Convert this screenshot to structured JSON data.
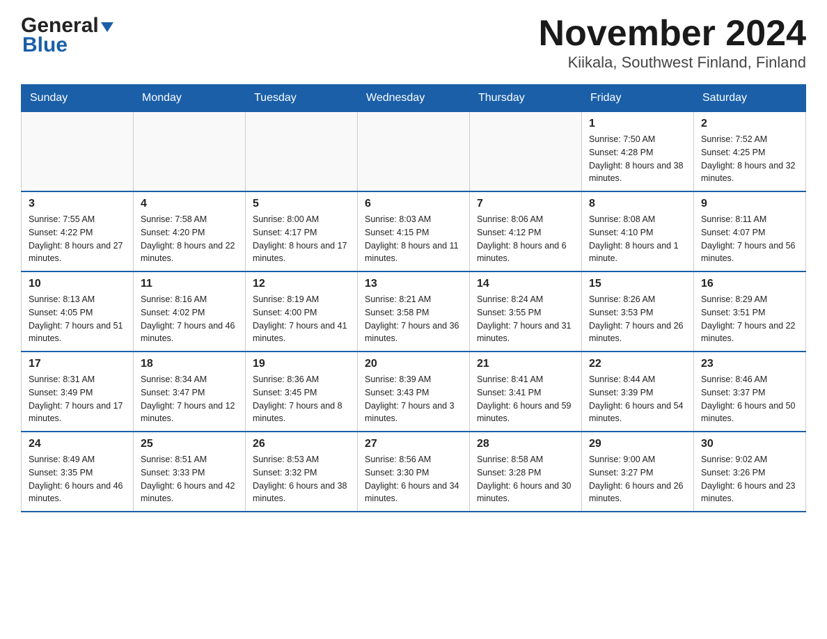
{
  "header": {
    "logo_general": "General",
    "logo_blue": "Blue",
    "title": "November 2024",
    "subtitle": "Kiikala, Southwest Finland, Finland"
  },
  "weekdays": [
    "Sunday",
    "Monday",
    "Tuesday",
    "Wednesday",
    "Thursday",
    "Friday",
    "Saturday"
  ],
  "weeks": [
    {
      "days": [
        {
          "number": "",
          "info": ""
        },
        {
          "number": "",
          "info": ""
        },
        {
          "number": "",
          "info": ""
        },
        {
          "number": "",
          "info": ""
        },
        {
          "number": "",
          "info": ""
        },
        {
          "number": "1",
          "info": "Sunrise: 7:50 AM\nSunset: 4:28 PM\nDaylight: 8 hours\nand 38 minutes."
        },
        {
          "number": "2",
          "info": "Sunrise: 7:52 AM\nSunset: 4:25 PM\nDaylight: 8 hours\nand 32 minutes."
        }
      ]
    },
    {
      "days": [
        {
          "number": "3",
          "info": "Sunrise: 7:55 AM\nSunset: 4:22 PM\nDaylight: 8 hours\nand 27 minutes."
        },
        {
          "number": "4",
          "info": "Sunrise: 7:58 AM\nSunset: 4:20 PM\nDaylight: 8 hours\nand 22 minutes."
        },
        {
          "number": "5",
          "info": "Sunrise: 8:00 AM\nSunset: 4:17 PM\nDaylight: 8 hours\nand 17 minutes."
        },
        {
          "number": "6",
          "info": "Sunrise: 8:03 AM\nSunset: 4:15 PM\nDaylight: 8 hours\nand 11 minutes."
        },
        {
          "number": "7",
          "info": "Sunrise: 8:06 AM\nSunset: 4:12 PM\nDaylight: 8 hours\nand 6 minutes."
        },
        {
          "number": "8",
          "info": "Sunrise: 8:08 AM\nSunset: 4:10 PM\nDaylight: 8 hours\nand 1 minute."
        },
        {
          "number": "9",
          "info": "Sunrise: 8:11 AM\nSunset: 4:07 PM\nDaylight: 7 hours\nand 56 minutes."
        }
      ]
    },
    {
      "days": [
        {
          "number": "10",
          "info": "Sunrise: 8:13 AM\nSunset: 4:05 PM\nDaylight: 7 hours\nand 51 minutes."
        },
        {
          "number": "11",
          "info": "Sunrise: 8:16 AM\nSunset: 4:02 PM\nDaylight: 7 hours\nand 46 minutes."
        },
        {
          "number": "12",
          "info": "Sunrise: 8:19 AM\nSunset: 4:00 PM\nDaylight: 7 hours\nand 41 minutes."
        },
        {
          "number": "13",
          "info": "Sunrise: 8:21 AM\nSunset: 3:58 PM\nDaylight: 7 hours\nand 36 minutes."
        },
        {
          "number": "14",
          "info": "Sunrise: 8:24 AM\nSunset: 3:55 PM\nDaylight: 7 hours\nand 31 minutes."
        },
        {
          "number": "15",
          "info": "Sunrise: 8:26 AM\nSunset: 3:53 PM\nDaylight: 7 hours\nand 26 minutes."
        },
        {
          "number": "16",
          "info": "Sunrise: 8:29 AM\nSunset: 3:51 PM\nDaylight: 7 hours\nand 22 minutes."
        }
      ]
    },
    {
      "days": [
        {
          "number": "17",
          "info": "Sunrise: 8:31 AM\nSunset: 3:49 PM\nDaylight: 7 hours\nand 17 minutes."
        },
        {
          "number": "18",
          "info": "Sunrise: 8:34 AM\nSunset: 3:47 PM\nDaylight: 7 hours\nand 12 minutes."
        },
        {
          "number": "19",
          "info": "Sunrise: 8:36 AM\nSunset: 3:45 PM\nDaylight: 7 hours\nand 8 minutes."
        },
        {
          "number": "20",
          "info": "Sunrise: 8:39 AM\nSunset: 3:43 PM\nDaylight: 7 hours\nand 3 minutes."
        },
        {
          "number": "21",
          "info": "Sunrise: 8:41 AM\nSunset: 3:41 PM\nDaylight: 6 hours\nand 59 minutes."
        },
        {
          "number": "22",
          "info": "Sunrise: 8:44 AM\nSunset: 3:39 PM\nDaylight: 6 hours\nand 54 minutes."
        },
        {
          "number": "23",
          "info": "Sunrise: 8:46 AM\nSunset: 3:37 PM\nDaylight: 6 hours\nand 50 minutes."
        }
      ]
    },
    {
      "days": [
        {
          "number": "24",
          "info": "Sunrise: 8:49 AM\nSunset: 3:35 PM\nDaylight: 6 hours\nand 46 minutes."
        },
        {
          "number": "25",
          "info": "Sunrise: 8:51 AM\nSunset: 3:33 PM\nDaylight: 6 hours\nand 42 minutes."
        },
        {
          "number": "26",
          "info": "Sunrise: 8:53 AM\nSunset: 3:32 PM\nDaylight: 6 hours\nand 38 minutes."
        },
        {
          "number": "27",
          "info": "Sunrise: 8:56 AM\nSunset: 3:30 PM\nDaylight: 6 hours\nand 34 minutes."
        },
        {
          "number": "28",
          "info": "Sunrise: 8:58 AM\nSunset: 3:28 PM\nDaylight: 6 hours\nand 30 minutes."
        },
        {
          "number": "29",
          "info": "Sunrise: 9:00 AM\nSunset: 3:27 PM\nDaylight: 6 hours\nand 26 minutes."
        },
        {
          "number": "30",
          "info": "Sunrise: 9:02 AM\nSunset: 3:26 PM\nDaylight: 6 hours\nand 23 minutes."
        }
      ]
    }
  ]
}
